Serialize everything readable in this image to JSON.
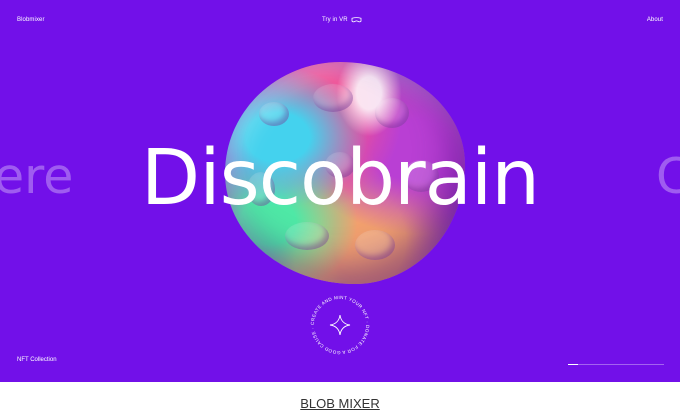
{
  "nav": {
    "brand": "Blobmixer",
    "vr_label": "Try in VR",
    "about": "About"
  },
  "hero": {
    "headline": "Discobrain",
    "side_left_word": "ere",
    "side_right_word": "C"
  },
  "badge": {
    "ring_text": "CREATE AND MINT YOUR NFT · DONATE FOR A GOOD CAUSE · "
  },
  "footer_link": "NFT Collection",
  "progress": {
    "fraction": 0.1
  },
  "caption": "BLOB MIXER",
  "colors": {
    "background": "#7210e9",
    "text": "#ffffff"
  }
}
